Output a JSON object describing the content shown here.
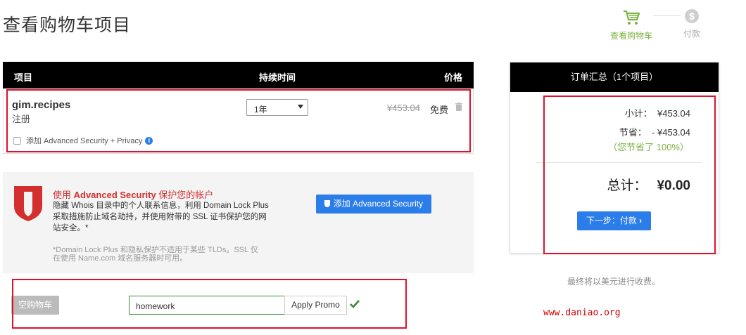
{
  "page": {
    "title": "查看购物车项目"
  },
  "steps": [
    {
      "label": "查看购物车",
      "icon": "cart-icon",
      "active": true
    },
    {
      "label": "付款",
      "icon": "dollar-coin-icon",
      "active": false
    }
  ],
  "cart": {
    "columns": {
      "item": "项目",
      "duration": "持续时间",
      "price": "价格"
    },
    "row": {
      "domain": "gim.recipes",
      "type": "注册",
      "term": "1年",
      "original_price": "¥453.04",
      "price_label": "免费",
      "addon_label": "添加 Advanced Security + Privacy"
    }
  },
  "security": {
    "title_prefix": "使用 ",
    "title_bold": "Advanced Security",
    "title_suffix": " 保护您的帐户",
    "description": "隐藏 Whois 目录中的个人联系信息，利用 Domain Lock Plus 采取措施防止域名劫持，并使用附带的 SSL 证书保护您的网站安全。*",
    "note": "*Domain Lock Plus 和隐私保护不适用于某些 TLDs。SSL 仅在使用 Name.com 域名服务器时可用。",
    "button_label": "添加 Advanced Security"
  },
  "promo": {
    "empty_cart_label": "空购物车",
    "code_value": "homework",
    "apply_label": "Apply Promo"
  },
  "summary": {
    "title": "订单汇总（1个项目）",
    "subtotal_label": "小计：",
    "subtotal_value": "¥453.04",
    "savings_label": "节省：",
    "savings_value": "- ¥453.04",
    "saved_text": "（您节省了 100%）",
    "total_label": "总计：",
    "total_value": "¥0.00",
    "next_label": "下一步：付款"
  },
  "footer": {
    "usd_note": "最终将以美元进行收费。",
    "watermark": "www.daniao.org"
  },
  "colors": {
    "accent_blue": "#2b7de9",
    "green": "#7cb342",
    "security_red": "#d32f2f",
    "annotation_red": "#e0102a"
  }
}
